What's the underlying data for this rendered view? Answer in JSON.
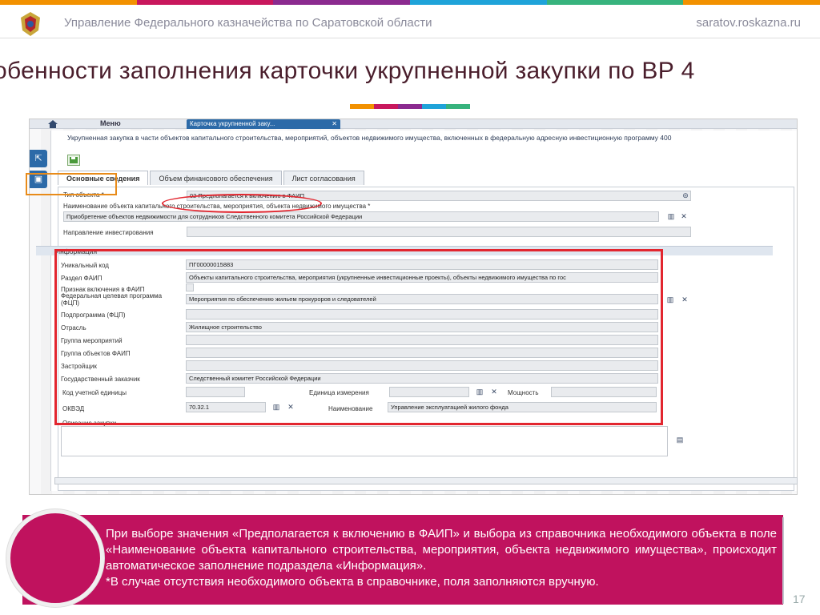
{
  "header": {
    "org": "Управление Федерального казначейства по Саратовской области",
    "site": "saratov.roskazna.ru",
    "logo": "treasury-emblem",
    "stripe_colors": [
      "#f29100",
      "#c8175d",
      "#8b2a8f",
      "#1fa3d9",
      "#37b37d",
      "#f29100"
    ]
  },
  "slide": {
    "title": "обенности заполнения карточки укрупненной закупки по ВР 4",
    "page_number": "17"
  },
  "app": {
    "menu": "Меню",
    "tab": "Карточка укрупненной заку...",
    "tab_close": "✕",
    "panel_title": "Укрупненная закупка в части объектов капитального строительства, мероприятий, объектов недвижимого имущества, включенных в федеральную адресную инвестиционную программу   400",
    "tabs": [
      "Основные сведения",
      "Объем финансового обеспечения",
      "Лист согласования"
    ],
    "fields": {
      "type_label": "Тип объекта *",
      "type_value": "02 Предполагается к включению в ФАИП",
      "name_label": "Наименование объекта капитального строительства, мероприятия, объекта недвижимого имущества *",
      "name_value": "Приобретение объектов недвижимости для сотрудников Следственного комитета Российской Федерации",
      "direction_label": "Направление инвестирования"
    },
    "info_section": "Информация",
    "info": [
      {
        "label": "Уникальный код",
        "value": "ПГ00000015883"
      },
      {
        "label": "Раздел ФАИП",
        "value": "Объекты капитального строительства, мероприятия (укрупненные инвестиционные проекты), объекты недвижимого имущества по гос"
      },
      {
        "label": "Признак включения в ФАИП",
        "value": ""
      },
      {
        "label": "Федеральная целевая программа (ФЦП)",
        "value": "Мероприятия по обеспечению жильем прокуроров и следователей"
      },
      {
        "label": "Подпрограмма (ФЦП)",
        "value": ""
      },
      {
        "label": "Отрасль",
        "value": "Жилищное строительство"
      },
      {
        "label": "Группа мероприятий",
        "value": ""
      },
      {
        "label": "Группа объектов ФАИП",
        "value": ""
      },
      {
        "label": "Застройщик",
        "value": ""
      },
      {
        "label": "Государственный заказчик",
        "value": "Следственный комитет Российской Федерации"
      }
    ],
    "unit_label": "Код учетной единицы",
    "measure_label": "Единица измерения",
    "power_label": "Мощность",
    "okved_label": "ОКВЭД",
    "okved_value": "70.32.1",
    "okved_name_label": "Наименование",
    "okved_name_value": "Управление эксплуатацией жилого фонда",
    "description_label": "Описание закупки"
  },
  "note": {
    "text": "При выборе значения «Предполагается к включению в ФАИП» и выбора из справочника необходимого объекта в поле «Наименование объекта капитального строительства, мероприятия, объекта недвижимого имущества», происходит автоматическое заполнение подраздела «Информация».",
    "footnote": "*В случае отсутствия необходимого объекта в справочнике, поля заполняются вручную."
  }
}
